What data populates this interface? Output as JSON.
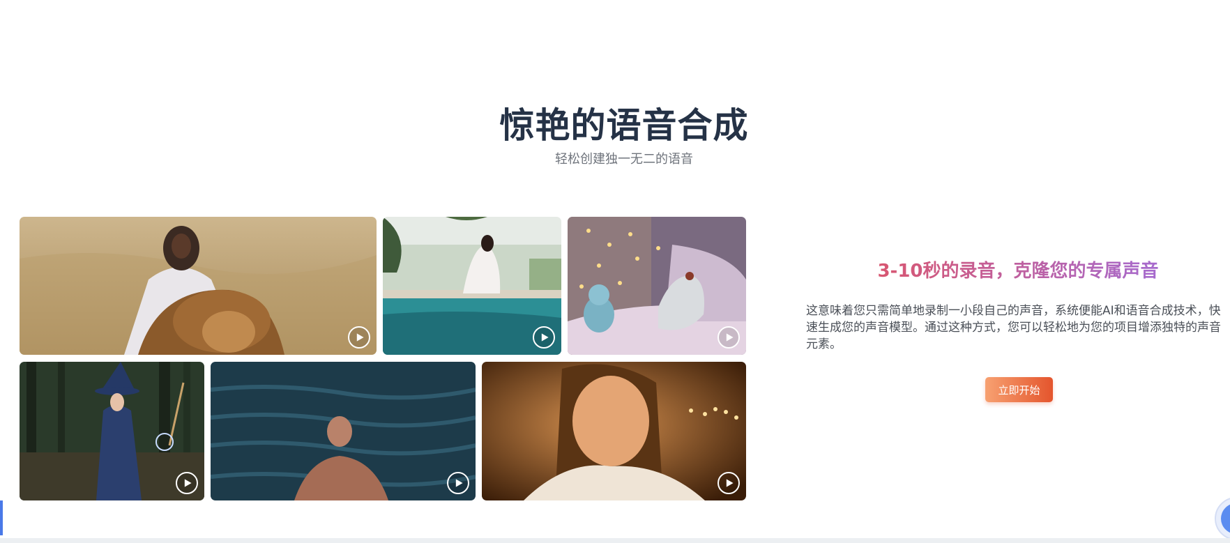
{
  "header": {
    "title": "惊艳的语音合成",
    "subtitle": "轻松创建独一无二的语音"
  },
  "gallery": {
    "play_icon": "play-icon",
    "cards": [
      {
        "scene": "woman-with-lion-in-field",
        "colors": [
          "#c9b183",
          "#8a6a3c"
        ]
      },
      {
        "scene": "woman-by-pool",
        "colors": [
          "#dfe6e0",
          "#2b8d94"
        ]
      },
      {
        "scene": "toy-dragon-on-bed",
        "colors": [
          "#8a6f8c",
          "#d7c8d8"
        ]
      },
      {
        "scene": "witch-in-forest",
        "colors": [
          "#2f3c2e",
          "#2a3d68"
        ]
      },
      {
        "scene": "man-in-water",
        "colors": [
          "#1a3b4c",
          "#2a5568"
        ]
      },
      {
        "scene": "woman-candlelight",
        "colors": [
          "#5a3210",
          "#d99b55"
        ]
      }
    ]
  },
  "feature": {
    "title": "3-10秒的录音，克隆您的专属声音",
    "description": "这意味着您只需简单地录制一小段自己的声音，系统便能AI和语音合成技术，快速生成您的声音模型。通过这种方式，您可以轻松地为您的项目增添独特的声音元素。",
    "cta_label": "立即开始"
  },
  "colors": {
    "title": "#253246",
    "accent_gradient": [
      "#f7a171",
      "#e4552d"
    ],
    "feature_gradient": [
      "#d9566f",
      "#a56bd0"
    ]
  }
}
